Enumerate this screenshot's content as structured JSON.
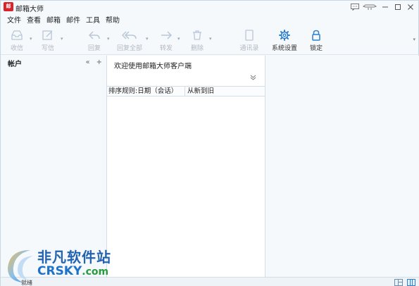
{
  "window": {
    "title": "邮箱大师",
    "logo_text": "邮"
  },
  "menu": [
    "文件",
    "查看",
    "邮箱",
    "邮件",
    "工具",
    "帮助"
  ],
  "toolbar": {
    "receive": "收信",
    "compose": "写信",
    "reply": "回复",
    "reply_all": "回复全部",
    "forward": "转发",
    "delete": "删除",
    "contacts": "通讯录",
    "settings": "系统设置",
    "lock": "锁定"
  },
  "left_pane": {
    "title": "帐户"
  },
  "middle_pane": {
    "welcome": "欢迎使用邮箱大师客户端",
    "sort_label": "排序规则:日期（会话）",
    "sort_order": "从新到旧"
  },
  "status": {
    "left_text": "就绪"
  },
  "watermark": {
    "chinese": "非凡软件站",
    "english": "CRSKY",
    "suffix": ".com"
  },
  "colors": {
    "accent": "#2d7fd0",
    "logo": "#d9222a",
    "disabled": "#b2b9c2"
  }
}
